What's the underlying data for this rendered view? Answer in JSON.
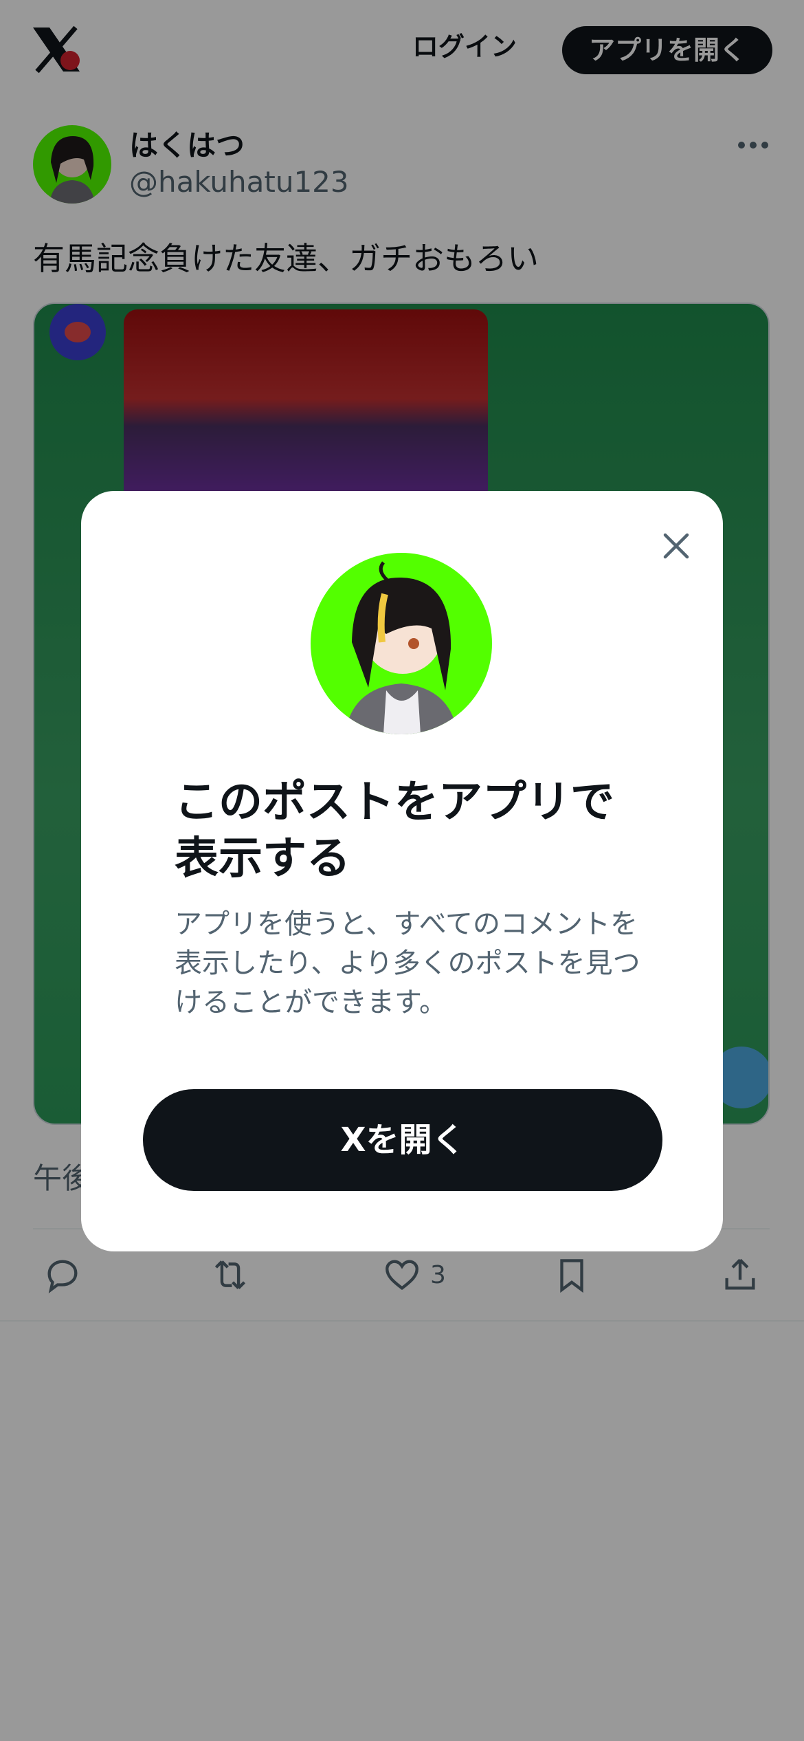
{
  "header": {
    "login_label": "ログイン",
    "open_app_label": "アプリを開く"
  },
  "post": {
    "display_name": "はくはつ",
    "handle": "@hakuhatu123",
    "text": "有馬記念負けた友達、ガチおもろい",
    "timestamp_visible": "午後",
    "like_count": "3"
  },
  "modal": {
    "title": "このポストをアプリで表示する",
    "description": "アプリを使うと、すべてのコメントを表示したり、より多くのポストを見つけることができます。",
    "cta_label": "Xを開く"
  },
  "colors": {
    "primary": "#0f1419",
    "secondary_text": "#536471",
    "avatar_bg": "#53ff00",
    "overlay": "rgba(0,0,0,0.40)"
  },
  "icons": [
    "x-logo-icon",
    "more-icon",
    "reply-icon",
    "repost-icon",
    "like-icon",
    "bookmark-icon",
    "share-icon",
    "close-icon"
  ]
}
